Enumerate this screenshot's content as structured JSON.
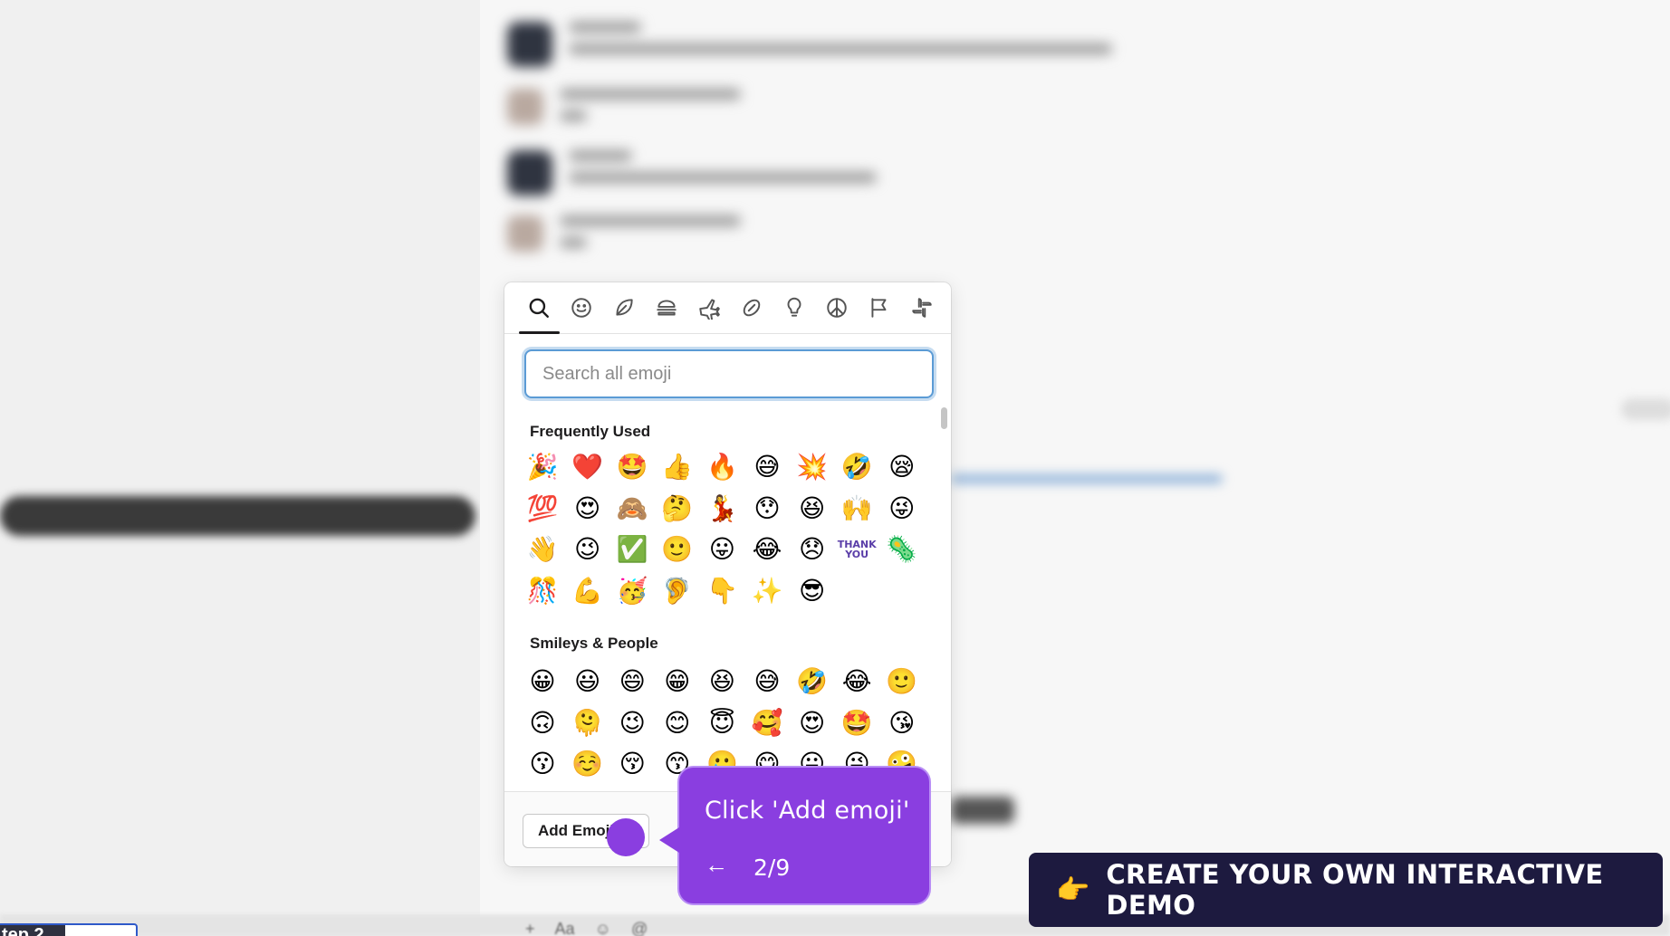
{
  "picker": {
    "categories": [
      {
        "name": "search",
        "icon": "search-icon"
      },
      {
        "name": "smileys",
        "icon": "smiley-icon"
      },
      {
        "name": "nature",
        "icon": "leaf-icon"
      },
      {
        "name": "food",
        "icon": "burger-icon"
      },
      {
        "name": "travel",
        "icon": "airplane-icon"
      },
      {
        "name": "activity",
        "icon": "football-icon"
      },
      {
        "name": "objects",
        "icon": "lightbulb-icon"
      },
      {
        "name": "symbols",
        "icon": "peace-icon"
      },
      {
        "name": "flags",
        "icon": "flag-icon"
      },
      {
        "name": "custom",
        "icon": "slack-icon"
      }
    ],
    "search_placeholder": "Search all emoji",
    "sections": [
      {
        "title": "Frequently Used",
        "emojis": [
          "🎉",
          "❤️",
          "🤩",
          "👍",
          "🔥",
          "😅",
          "💥",
          "🤣",
          "😪",
          "💯",
          "😍",
          "🙈",
          "🤔",
          "💃",
          "😯",
          "😆",
          "🙌",
          "😜",
          "👋",
          "😉",
          "✅",
          "🙂",
          "😛",
          "😂",
          "😞",
          "THANK YOU",
          "🦠",
          "🎊",
          "💪",
          "🥳",
          "🦻",
          "👇",
          "✨",
          "😎"
        ]
      },
      {
        "title": "Smileys & People",
        "emojis": [
          "😀",
          "😃",
          "😄",
          "😁",
          "😆",
          "😅",
          "🤣",
          "😂",
          "🙂",
          "🙃",
          "🫠",
          "😉",
          "😊",
          "😇",
          "🥰",
          "😍",
          "🤩",
          "😘",
          "😗",
          "☺️",
          "😚",
          "😙",
          "🥲",
          "😋",
          "😛",
          "😜",
          "🤪",
          "😝",
          "🤑",
          "🤗"
        ]
      }
    ],
    "add_emoji_label": "Add Emoji"
  },
  "tooltip": {
    "text": "Click 'Add emoji'",
    "back_icon": "←",
    "step": "2/9"
  },
  "cta": {
    "icon": "👉",
    "label": "CREATE YOUR OWN INTERACTIVE DEMO"
  },
  "step_tag": {
    "label": "tep 2"
  },
  "colors": {
    "accent_purple": "#8a3ee0",
    "cta_bg": "#1d1a3f",
    "search_focus": "#5b9bd5"
  }
}
